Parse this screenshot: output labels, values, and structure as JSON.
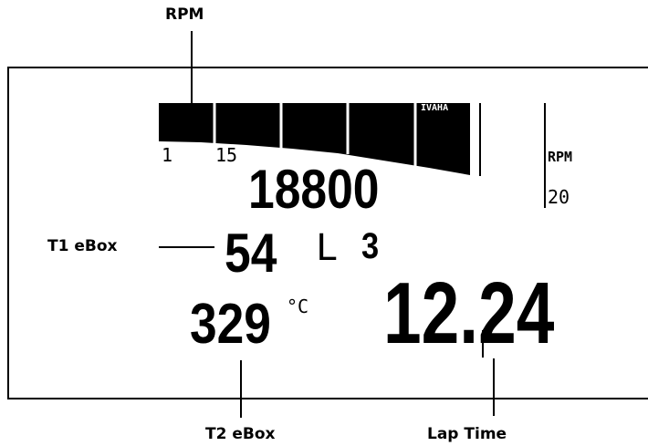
{
  "callouts": {
    "rpm": "RPM",
    "t1": "T1 eBox",
    "t2": "T2 eBox",
    "lap": "Lap Time"
  },
  "display": {
    "bar_label_start": "1",
    "bar_label_15": "15",
    "bar_corner_text": "IVAHA",
    "side_rpm_label": "RPM",
    "side_rpm_value": "20",
    "rpm_value": "18800",
    "t1_value": "54",
    "gear": "L",
    "lap_number": "3",
    "t2_value": "329",
    "t2_unit": "°C",
    "lap_time": "12.24"
  },
  "colors": {
    "ink": "#000000",
    "background": "#ffffff"
  }
}
